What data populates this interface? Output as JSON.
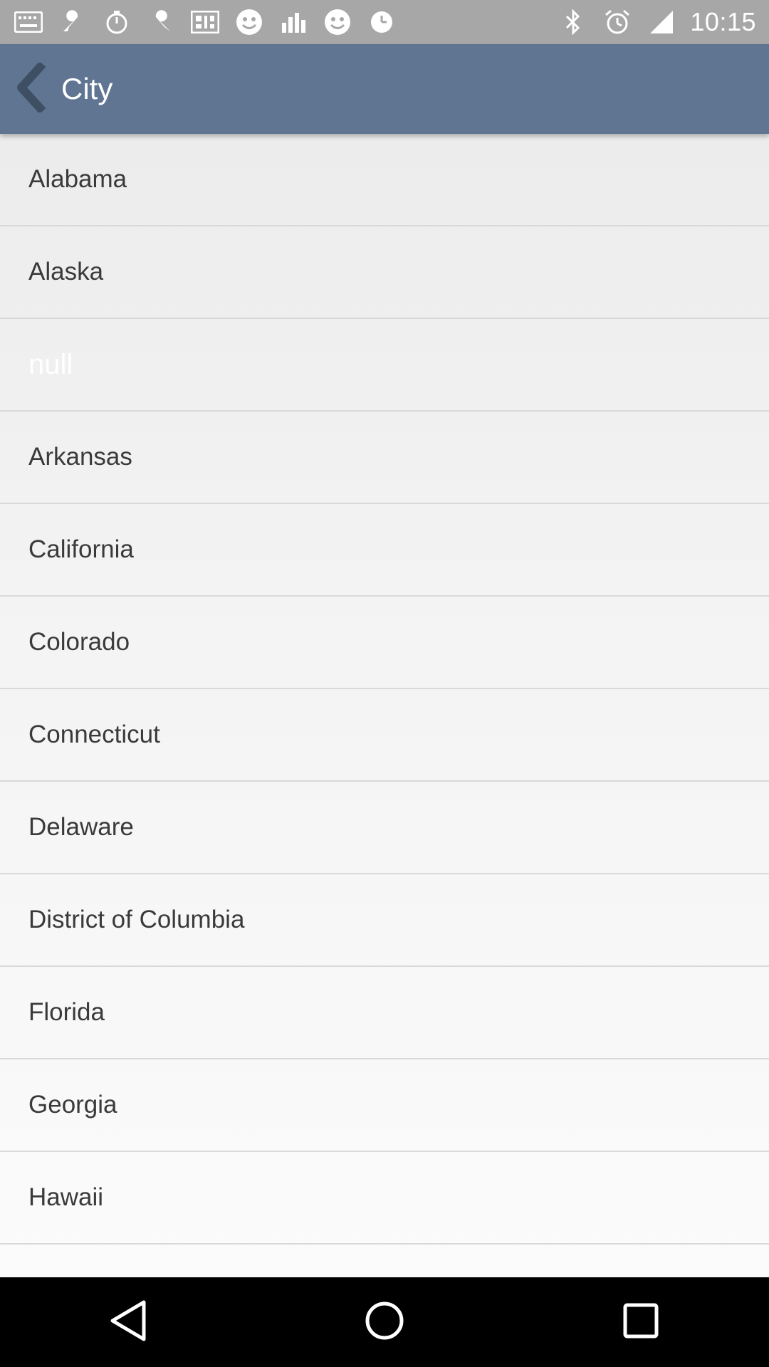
{
  "status_bar": {
    "time": "10:15",
    "left_icons": [
      "notification-icon",
      "wrench-icon",
      "timer-icon",
      "wrench-icon",
      "qr-icon",
      "smiley-icon",
      "chart-icon",
      "smiley-icon",
      "clock-icon"
    ],
    "right_icons": [
      "bluetooth-icon",
      "alarm-icon",
      "signal-icon"
    ]
  },
  "app_bar": {
    "title": "City",
    "color": "#5f7592"
  },
  "list": {
    "items": [
      {
        "label": "Alabama"
      },
      {
        "label": "Alaska"
      },
      {
        "label": "null"
      },
      {
        "label": "Arkansas"
      },
      {
        "label": "California"
      },
      {
        "label": "Colorado"
      },
      {
        "label": "Connecticut"
      },
      {
        "label": "Delaware"
      },
      {
        "label": "District of Columbia"
      },
      {
        "label": "Florida"
      },
      {
        "label": "Georgia"
      },
      {
        "label": "Hawaii"
      },
      {
        "label": ""
      }
    ]
  },
  "nav_bar": {
    "buttons": [
      "back-icon",
      "home-icon",
      "recents-icon"
    ]
  }
}
